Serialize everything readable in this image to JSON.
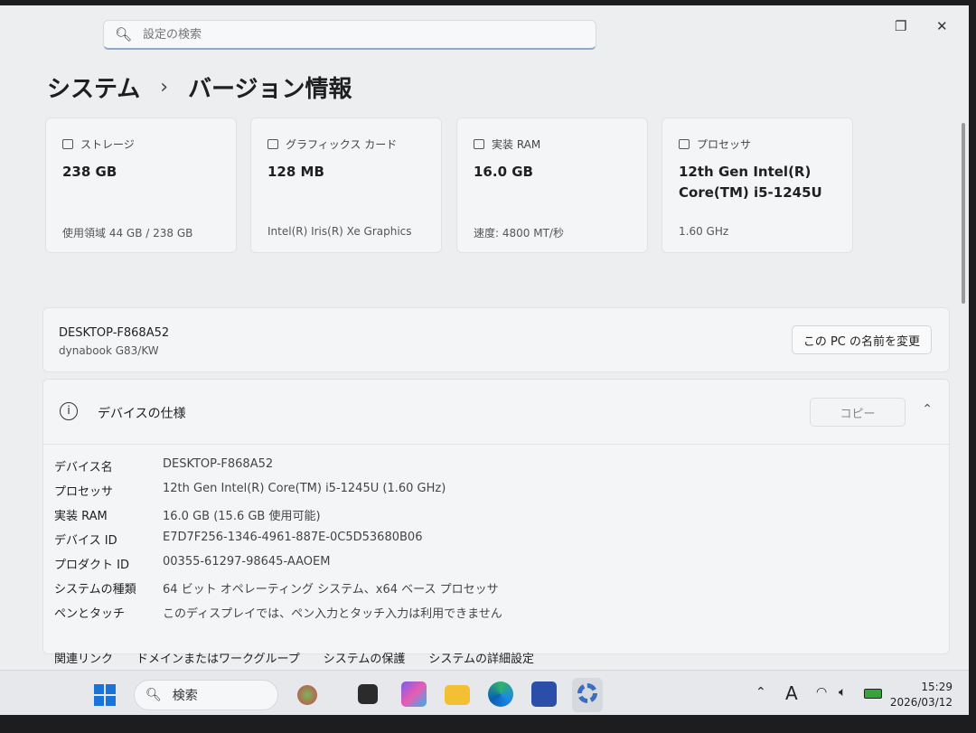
{
  "search": {
    "placeholder": "設定の検索"
  },
  "breadcrumb": {
    "parent": "システム",
    "separator": "›",
    "current": "バージョン情報"
  },
  "cards": [
    {
      "title": "ストレージ",
      "icon": "storage-icon",
      "value": "238 GB",
      "sub": "使用領域 44 GB / 238 GB"
    },
    {
      "title": "グラフィックス カード",
      "icon": "graphics-card-icon",
      "value": "128 MB",
      "sub": "Intel(R) Iris(R) Xe Graphics"
    },
    {
      "title": "実装 RAM",
      "icon": "ram-icon",
      "value": "16.0 GB",
      "sub": "速度: 4800 MT/秒"
    },
    {
      "title": "プロセッサ",
      "icon": "processor-icon",
      "value": "12th Gen Intel(R) Core(TM) i5-1245U",
      "sub": "1.60 GHz"
    }
  ],
  "device": {
    "name": "DESKTOP-F868A52",
    "model": "dynabook G83/KW",
    "rename_label": "この PC の名前を変更"
  },
  "specs": {
    "title": "デバイスの仕様",
    "copy_label": "コピー",
    "rows": [
      {
        "key": "デバイス名",
        "value": "DESKTOP-F868A52"
      },
      {
        "key": "プロセッサ",
        "value": "12th Gen Intel(R) Core(TM) i5-1245U (1.60 GHz)"
      },
      {
        "key": "実装 RAM",
        "value": "16.0 GB (15.6 GB 使用可能)"
      },
      {
        "key": "デバイス ID",
        "value": "E7D7F256-1346-4961-887E-0C5D53680B06"
      },
      {
        "key": "プロダクト ID",
        "value": "00355-61297-98645-AAOEM"
      },
      {
        "key": "システムの種類",
        "value": "64 ビット オペレーティング システム、x64 ベース プロセッサ"
      },
      {
        "key": "ペンとタッチ",
        "value": "このディスプレイでは、ペン入力とタッチ入力は利用できません"
      }
    ]
  },
  "related": {
    "label": "関連リンク",
    "links": [
      "ドメインまたはワークグループ",
      "システムの保護",
      "システムの詳細設定"
    ]
  },
  "taskbar": {
    "search_label": "検索",
    "ime": "A",
    "time": "15:29",
    "date": "2026/03/12"
  }
}
